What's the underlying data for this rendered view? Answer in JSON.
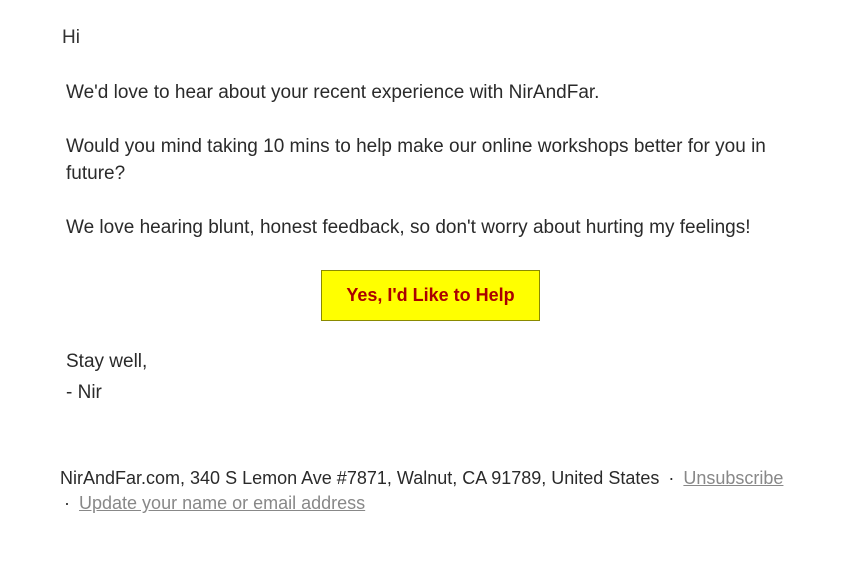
{
  "greeting": "Hi",
  "paragraphs": {
    "p1": "We'd love to hear about your recent experience with NirAndFar.",
    "p2": "Would you mind taking 10 mins to help make our online workshops better for you in future?",
    "p3": "We love hearing blunt, honest feedback, so don't worry about hurting my feelings!"
  },
  "cta": {
    "label": "Yes, I'd Like to Help"
  },
  "signoff": "Stay well,",
  "signature": "- Nir",
  "footer": {
    "address": "NirAndFar.com, 340 S Lemon Ave #7871, Walnut, CA 91789, United States",
    "sep": "·",
    "unsubscribe": "Unsubscribe",
    "update": "Update your name or email address"
  }
}
